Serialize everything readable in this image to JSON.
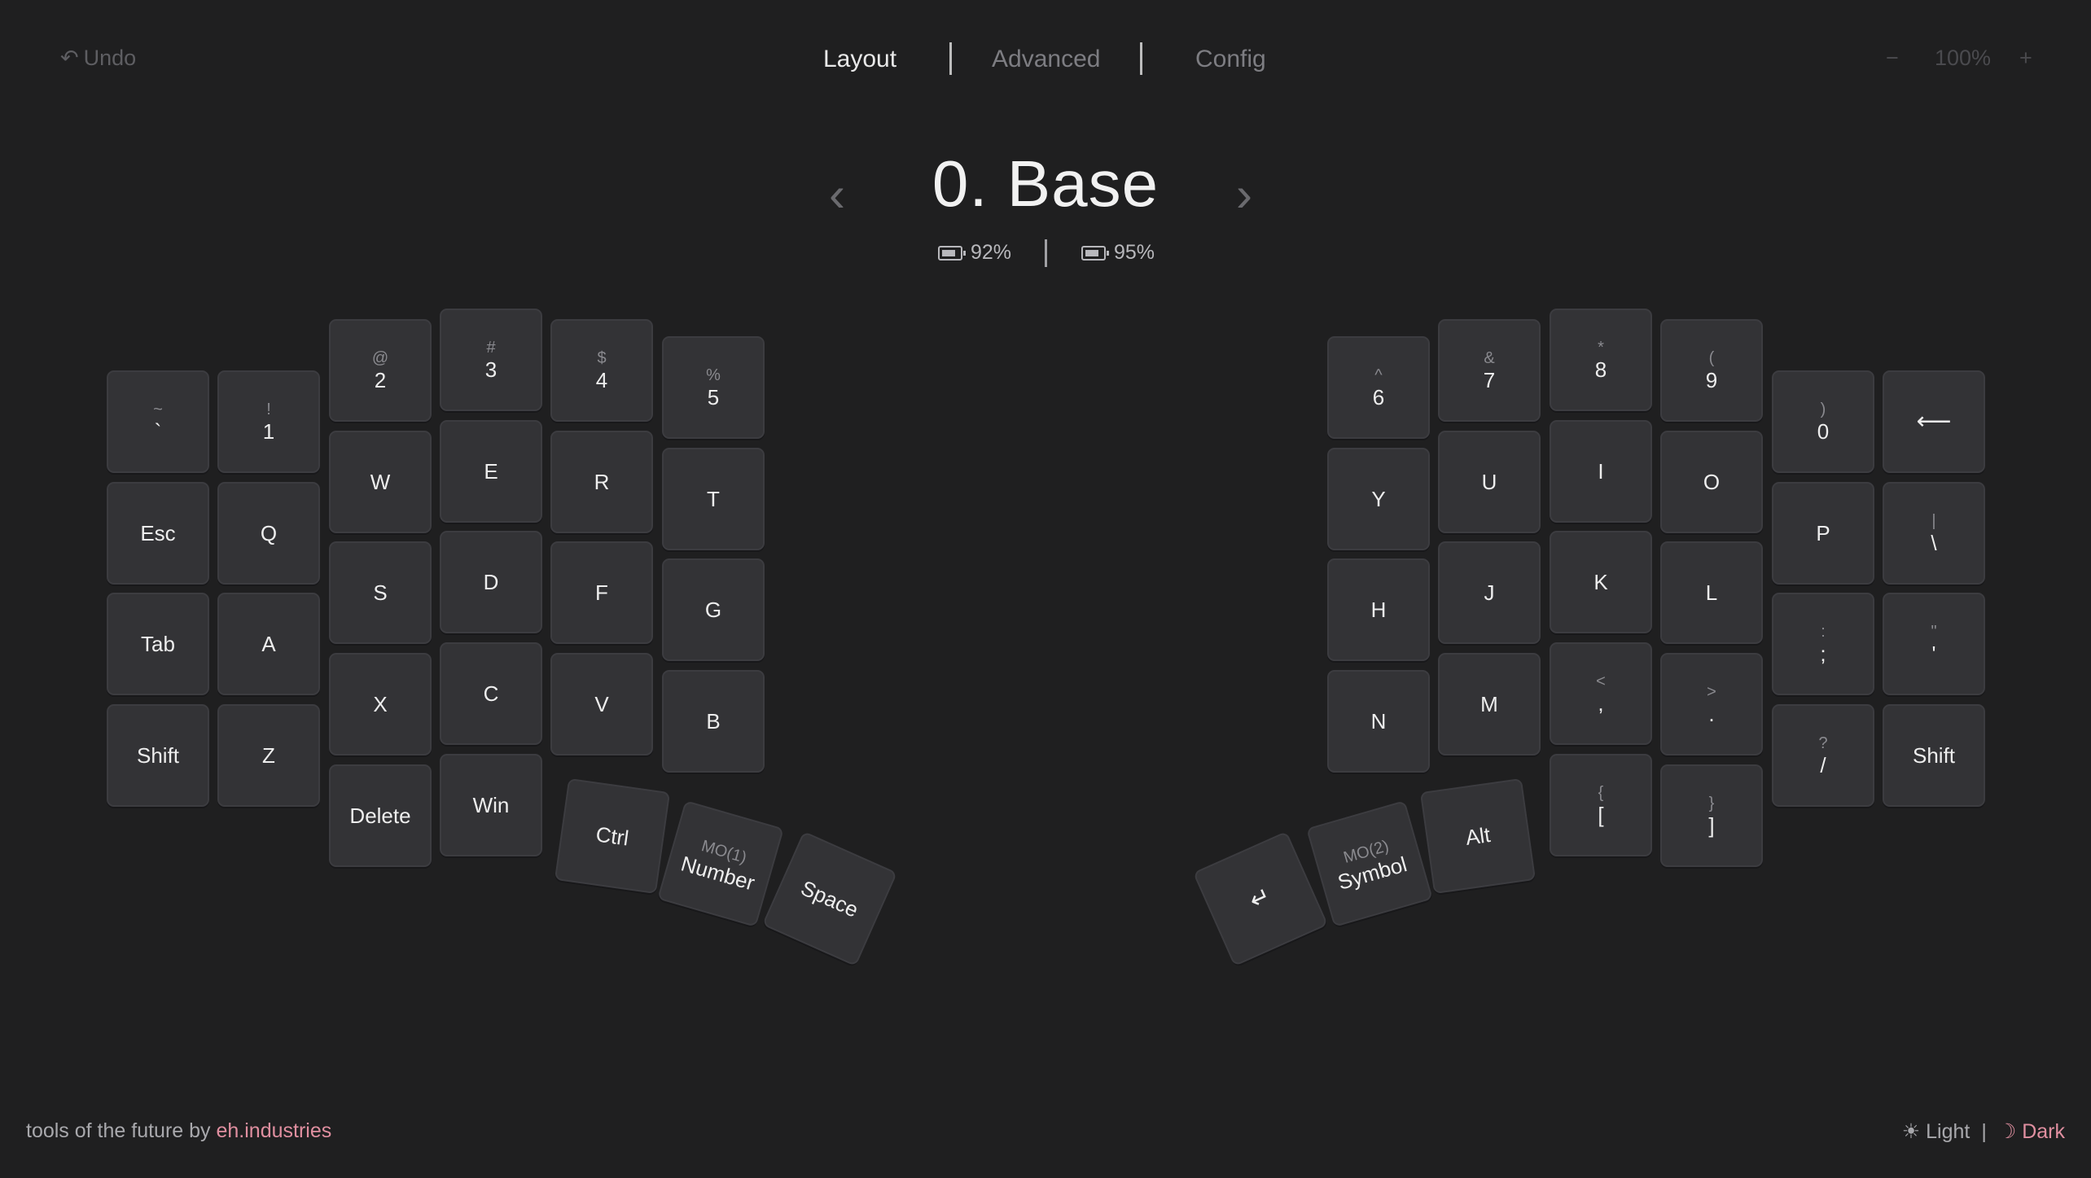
{
  "toolbar": {
    "undo_icon": "↶",
    "undo_label": "Undo",
    "zoom_out": "−",
    "zoom_level": "100%",
    "zoom_in": "+"
  },
  "nav": {
    "tabs": [
      {
        "label": "Layout",
        "active": true
      },
      {
        "label": "Advanced",
        "active": false
      },
      {
        "label": "Config",
        "active": false
      }
    ]
  },
  "layer": {
    "title": "0. Base",
    "prev_icon": "‹",
    "next_icon": "›",
    "battery_left": "92%",
    "battery_right": "95%"
  },
  "keys": {
    "left": [
      {
        "sub": "~",
        "main": "`"
      },
      {
        "sub": "!",
        "main": "1"
      },
      {
        "sub": "@",
        "main": "2"
      },
      {
        "sub": "#",
        "main": "3"
      },
      {
        "sub": "$",
        "main": "4"
      },
      {
        "sub": "%",
        "main": "5"
      },
      {
        "sub": "",
        "main": "Esc"
      },
      {
        "sub": "",
        "main": "Q"
      },
      {
        "sub": "",
        "main": "W"
      },
      {
        "sub": "",
        "main": "E"
      },
      {
        "sub": "",
        "main": "R"
      },
      {
        "sub": "",
        "main": "T"
      },
      {
        "sub": "",
        "main": "Tab"
      },
      {
        "sub": "",
        "main": "A"
      },
      {
        "sub": "",
        "main": "S"
      },
      {
        "sub": "",
        "main": "D"
      },
      {
        "sub": "",
        "main": "F"
      },
      {
        "sub": "",
        "main": "G"
      },
      {
        "sub": "",
        "main": "Shift"
      },
      {
        "sub": "",
        "main": "Z"
      },
      {
        "sub": "",
        "main": "X"
      },
      {
        "sub": "",
        "main": "C"
      },
      {
        "sub": "",
        "main": "V"
      },
      {
        "sub": "",
        "main": "B"
      },
      {
        "sub": "",
        "main": "Delete"
      },
      {
        "sub": "",
        "main": "Win"
      },
      {
        "sub": "",
        "main": "Ctrl"
      },
      {
        "sub": "MO(1)",
        "main": "Number"
      },
      {
        "sub": "",
        "main": "Space"
      }
    ],
    "right": [
      {
        "sub": "^",
        "main": "6"
      },
      {
        "sub": "&",
        "main": "7"
      },
      {
        "sub": "*",
        "main": "8"
      },
      {
        "sub": "(",
        "main": "9"
      },
      {
        "sub": ")",
        "main": "0"
      },
      {
        "sub": "",
        "main": "⟵"
      },
      {
        "sub": "",
        "main": "Y"
      },
      {
        "sub": "",
        "main": "U"
      },
      {
        "sub": "",
        "main": "I"
      },
      {
        "sub": "",
        "main": "O"
      },
      {
        "sub": "",
        "main": "P"
      },
      {
        "sub": "|",
        "main": "\\"
      },
      {
        "sub": "",
        "main": "H"
      },
      {
        "sub": "",
        "main": "J"
      },
      {
        "sub": "",
        "main": "K"
      },
      {
        "sub": "",
        "main": "L"
      },
      {
        "sub": ":",
        "main": ";"
      },
      {
        "sub": "\"",
        "main": "'"
      },
      {
        "sub": "",
        "main": "N"
      },
      {
        "sub": "",
        "main": "M"
      },
      {
        "sub": "<",
        "main": ","
      },
      {
        "sub": ">",
        "main": "."
      },
      {
        "sub": "?",
        "main": "/"
      },
      {
        "sub": "",
        "main": "Shift"
      },
      {
        "sub": "{",
        "main": "["
      },
      {
        "sub": "}",
        "main": "]"
      },
      {
        "sub": "",
        "main": "Alt"
      },
      {
        "sub": "MO(2)",
        "main": "Symbol"
      },
      {
        "sub": "",
        "main": "↵"
      }
    ]
  },
  "footer": {
    "prefix": "tools of the future by",
    "brand": "eh.industries",
    "light_icon": "☀",
    "light_label": "Light",
    "sep": "|",
    "dark_icon": "☽",
    "dark_label": "Dark"
  }
}
